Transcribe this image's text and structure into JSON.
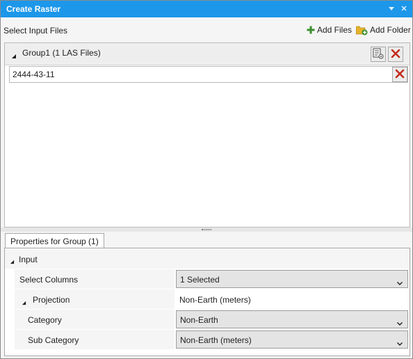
{
  "window": {
    "title": "Create Raster"
  },
  "files": {
    "header_label": "Select Input Files",
    "add_files_label": "Add Files",
    "add_folder_label": "Add Folder",
    "group": {
      "label": "Group1 (1 LAS Files)",
      "items": [
        {
          "name": "2444-43-11"
        }
      ]
    }
  },
  "properties": {
    "tab_label": "Properties for Group (1)",
    "section_label": "Input",
    "rows": [
      {
        "name": "Select Columns",
        "value": "1 Selected"
      },
      {
        "name": "Projection",
        "value": "Non-Earth (meters)"
      },
      {
        "name": "Category",
        "value": "Non-Earth"
      },
      {
        "name": "Sub Category",
        "value": "Non-Earth (meters)"
      }
    ]
  },
  "colors": {
    "title_bar": "#1c97ea",
    "delete_red": "#c42b1c",
    "add_green": "#3c8d2f",
    "folder_yellow": "#e7b42c"
  },
  "icons": [
    "pin-icon",
    "close-icon",
    "add-icon",
    "folder-add-icon",
    "group-settings-icon",
    "delete-icon",
    "expand-triangle-icon",
    "chevron-down-icon"
  ]
}
